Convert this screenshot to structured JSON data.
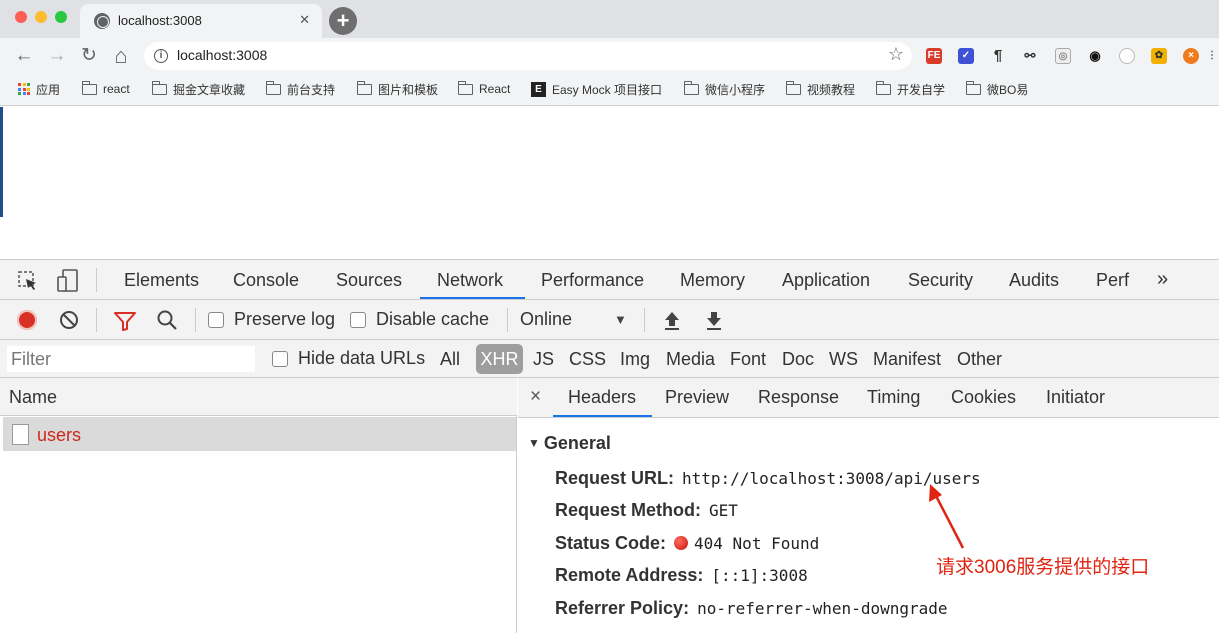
{
  "window": {
    "tab_title": "localhost:3008",
    "tab_close": "✕",
    "new_tab": "+"
  },
  "toolbar": {
    "back": "←",
    "forward": "→",
    "reload": "↻",
    "home": "⌂",
    "url": "localhost:3008",
    "extensions": [
      "fe-helper-icon",
      "pocket-icon",
      "paragraph-icon",
      "link-icon",
      "extension-icon",
      "eye-icon",
      "stopwatch-icon",
      "bee-icon",
      "close-circle-icon"
    ]
  },
  "bookmarks": [
    {
      "label": "应用",
      "icon": "apps-icon"
    },
    {
      "label": "react",
      "icon": "folder-icon"
    },
    {
      "label": "掘金文章收藏",
      "icon": "folder-icon"
    },
    {
      "label": "前台支持",
      "icon": "folder-icon"
    },
    {
      "label": "图片和模板",
      "icon": "folder-icon"
    },
    {
      "label": "React",
      "icon": "folder-icon"
    },
    {
      "label": "Easy Mock 项目接口",
      "icon": "easymock-icon"
    },
    {
      "label": "微信小程序",
      "icon": "folder-icon"
    },
    {
      "label": "视频教程",
      "icon": "folder-icon"
    },
    {
      "label": "开发自学",
      "icon": "folder-icon"
    },
    {
      "label": "微BO易",
      "icon": "folder-icon"
    }
  ],
  "devtools": {
    "tabs": [
      "Elements",
      "Console",
      "Sources",
      "Network",
      "Performance",
      "Memory",
      "Application",
      "Security",
      "Audits",
      "Perf"
    ],
    "active_tab": "Network",
    "more_tabs": "»",
    "network_toolbar": {
      "preserve_log": "Preserve log",
      "disable_cache": "Disable cache",
      "throttling": "Online"
    },
    "filter": {
      "placeholder": "Filter",
      "hide_data_urls": "Hide data URLs",
      "types": [
        "All",
        "XHR",
        "JS",
        "CSS",
        "Img",
        "Media",
        "Font",
        "Doc",
        "WS",
        "Manifest",
        "Other"
      ],
      "active_type": "XHR"
    },
    "requests": {
      "column_name": "Name",
      "rows": [
        {
          "name": "users"
        }
      ]
    },
    "details": {
      "close": "×",
      "tabs": [
        "Headers",
        "Preview",
        "Response",
        "Timing",
        "Cookies",
        "Initiator"
      ],
      "active_tab": "Headers",
      "section": "General",
      "general": [
        {
          "key": "Request URL:",
          "value": "http://localhost:3008/api/users"
        },
        {
          "key": "Request Method:",
          "value": "GET"
        },
        {
          "key": "Status Code:",
          "value": "404 Not Found",
          "status_color": "#d0271c"
        },
        {
          "key": "Remote Address:",
          "value": "[::1]:3008"
        },
        {
          "key": "Referrer Policy:",
          "value": "no-referrer-when-downgrade"
        }
      ]
    }
  },
  "annotation": {
    "text": "请求3006服务提供的接口",
    "color": "#e02412"
  }
}
